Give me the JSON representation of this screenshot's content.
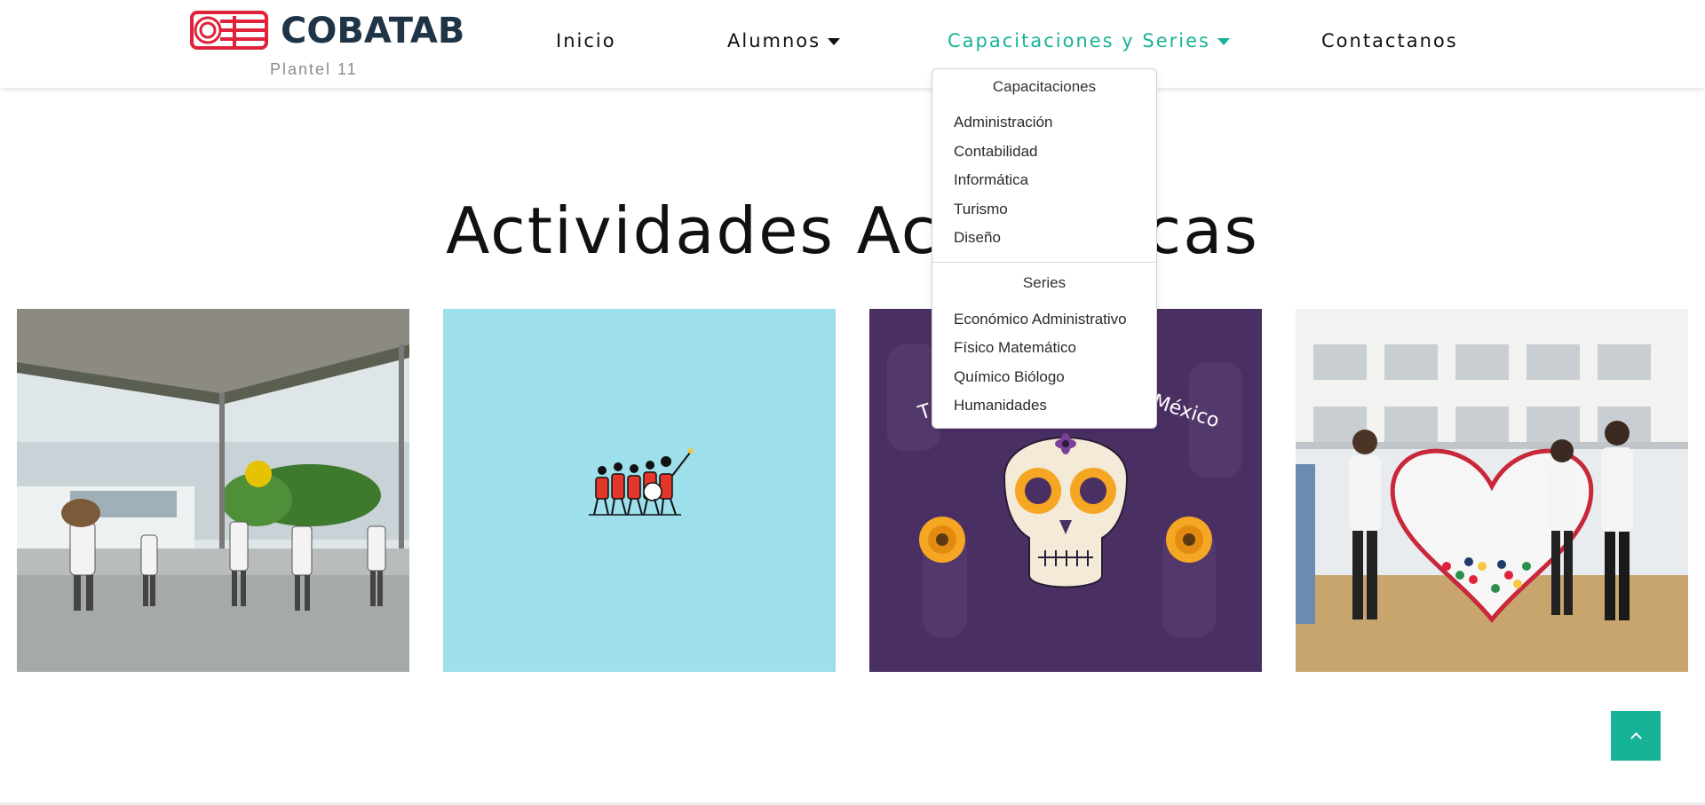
{
  "header": {
    "logo_text": "COBATAB",
    "logo_subtitle": "Plantel 11",
    "nav": [
      {
        "label": "Inicio",
        "has_caret": false
      },
      {
        "label": "Alumnos",
        "has_caret": true
      },
      {
        "label": "Capacitaciones y Series",
        "has_caret": true,
        "active": true
      },
      {
        "label": "Contactanos",
        "has_caret": false
      }
    ]
  },
  "dropdown": {
    "capacitaciones_header": "Capacitaciones",
    "capacitaciones": [
      "Administración",
      "Contabilidad",
      "Informática",
      "Turismo",
      "Diseño"
    ],
    "series_header": "Series",
    "series": [
      "Económico Administrativo",
      "Físico Matemático",
      "Químico Biólogo",
      "Humanidades"
    ]
  },
  "main": {
    "title": "Actividades Académicas",
    "tiles": [
      {
        "description": "photo-basketball-court"
      },
      {
        "description": "marching-band-illustration"
      },
      {
        "description": "day-of-the-dead-skull"
      },
      {
        "description": "photo-group-heart-sculpture"
      }
    ],
    "tile3_caption": "T... México"
  },
  "colors": {
    "accent": "#17b396",
    "logo_red": "#e0233b",
    "logo_navy": "#1f3446",
    "tile2_bg": "#9ddfea",
    "tile3_bg": "#4a2f63"
  },
  "icons": {
    "back_to_top": "chevron-up-icon",
    "nav_caret": "caret-down-icon"
  }
}
